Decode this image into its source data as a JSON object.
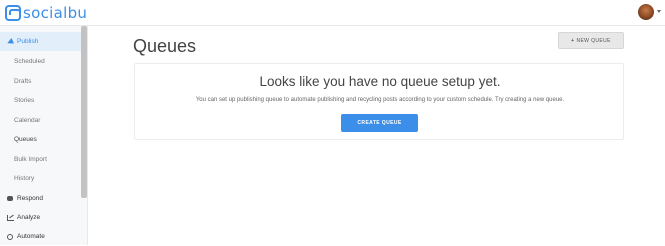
{
  "brand": {
    "name": "socialbu"
  },
  "topbar": {
    "avatar_icon": "user-avatar",
    "menu_caret_icon": "caret-down-icon"
  },
  "sidebar": {
    "items": [
      {
        "label": "Publish",
        "icon": "paper-plane-icon",
        "active": true
      },
      {
        "label": "Scheduled"
      },
      {
        "label": "Drafts"
      },
      {
        "label": "Stories"
      },
      {
        "label": "Calendar"
      },
      {
        "label": "Queues"
      },
      {
        "label": "Bulk Import"
      },
      {
        "label": "History"
      },
      {
        "label": "Respond",
        "icon": "chat-icon"
      },
      {
        "label": "Analyze",
        "icon": "chart-icon"
      },
      {
        "label": "Automate",
        "icon": "cogs-icon"
      }
    ]
  },
  "main": {
    "title": "Queues",
    "new_queue_button": {
      "plus": "+",
      "label": "NEW QUEUE"
    },
    "empty_state": {
      "heading": "Looks like you have no queue setup yet.",
      "description": "You can set up publishing queue to automate publishing and recycling posts according to your custom schedule. Try creating a new queue.",
      "create_button": "CREATE QUEUE"
    }
  },
  "colors": {
    "accent": "#3b8fe8",
    "sidebar_bg": "#f7f8fa",
    "active_bg": "#e3eefb"
  }
}
